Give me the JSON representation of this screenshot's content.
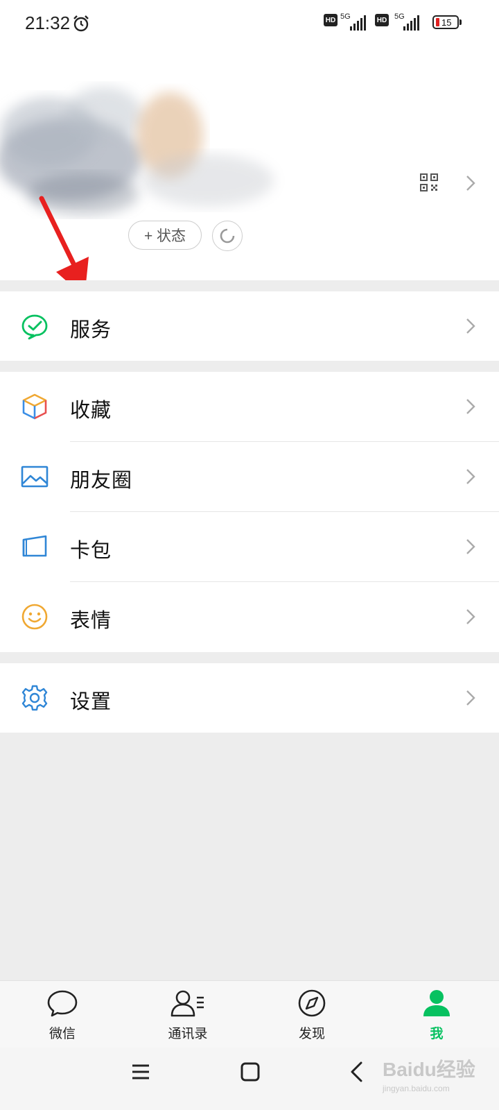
{
  "status_bar": {
    "time": "21:32",
    "hd_label": "HD",
    "network_label": "5G",
    "battery_level": "15"
  },
  "profile": {
    "add_status_label": "+ 状态"
  },
  "menu": {
    "service": "服务",
    "favorites": "收藏",
    "moments": "朋友圈",
    "cards": "卡包",
    "stickers": "表情",
    "settings": "设置"
  },
  "tabbar": {
    "chats": "微信",
    "contacts": "通讯录",
    "discover": "发现",
    "me": "我",
    "active_color": "#07c160"
  },
  "watermark": {
    "brand": "Baidu经验",
    "url": "jingyan.baidu.com"
  },
  "annotation": {
    "arrow_color": "#e8201f"
  }
}
